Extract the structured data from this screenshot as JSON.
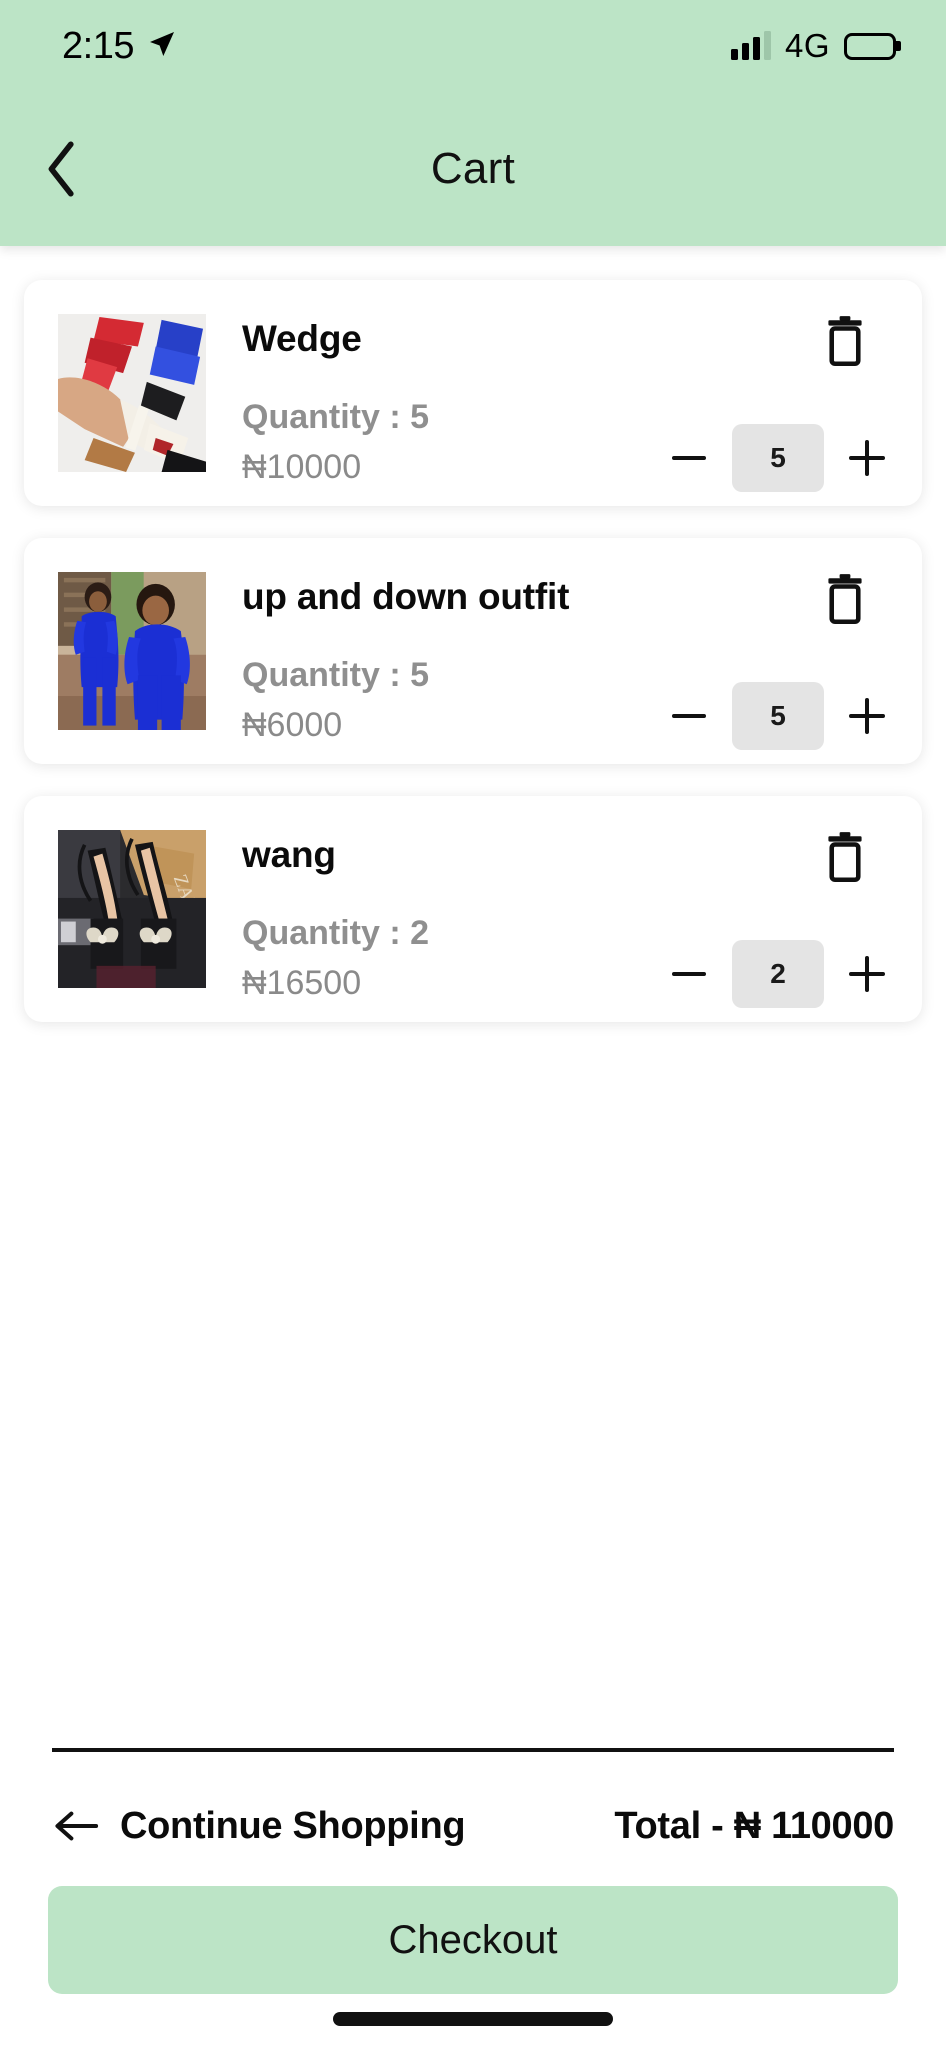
{
  "status_bar": {
    "time": "2:15",
    "location_icon": "location-arrow-icon",
    "signal_icon": "signal-bars-icon",
    "network": "4G",
    "battery_icon": "battery-icon"
  },
  "header": {
    "back_icon": "chevron-left-icon",
    "title": "Cart",
    "background_color": "#bce4c6"
  },
  "cart": {
    "currency": "₦",
    "items": [
      {
        "name": "Wedge",
        "quantity_label": "Quantity : 5",
        "price": "₦10000",
        "stepper_value": "5",
        "decrement_label": "−",
        "increment_label": "+",
        "delete_icon": "trash-icon",
        "thumbnail": "wedge-sandals-photo"
      },
      {
        "name": "up and down outfit",
        "quantity_label": "Quantity : 5",
        "price": "₦6000",
        "stepper_value": "5",
        "decrement_label": "−",
        "increment_label": "+",
        "delete_icon": "trash-icon",
        "thumbnail": "blue-jumpsuit-photo"
      },
      {
        "name": "wang",
        "quantity_label": "Quantity : 2",
        "price": "₦16500",
        "stepper_value": "2",
        "decrement_label": "−",
        "increment_label": "+",
        "delete_icon": "trash-icon",
        "thumbnail": "black-slingback-heels-photo"
      }
    ]
  },
  "footer": {
    "continue_icon": "arrow-left-icon",
    "continue_label": "Continue Shopping",
    "total_label": "Total - ₦ 110000",
    "checkout_label": "Checkout",
    "checkout_color": "#bce4c6"
  }
}
